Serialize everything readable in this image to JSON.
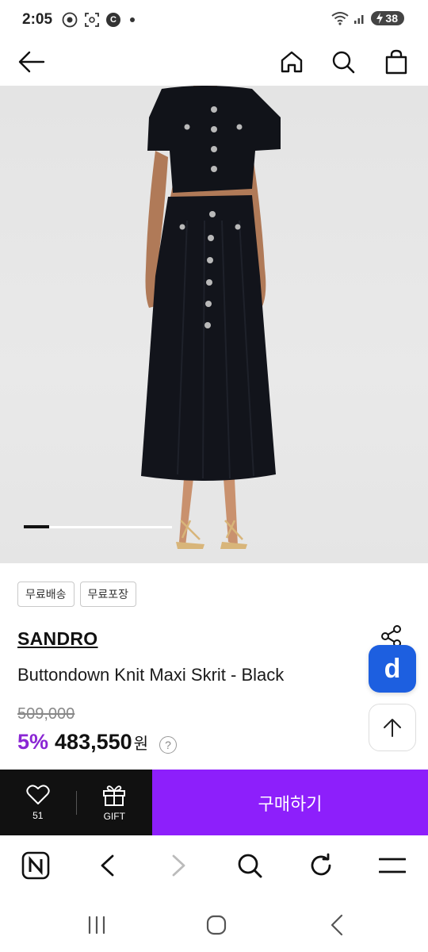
{
  "status_bar": {
    "time": "2:05",
    "notification_icon_label": "C",
    "battery": "38"
  },
  "top_nav": {
    "back_icon": "back-arrow-icon",
    "home_icon": "home-icon",
    "search_icon": "search-icon",
    "cart_icon": "shopping-bag-icon"
  },
  "product": {
    "tags": [
      "무료배송",
      "무료포장"
    ],
    "brand": "SANDRO",
    "name": "Buttondown Knit Maxi Skrit - Black",
    "original_price": "509,000",
    "discount": "5%",
    "sale_price": "483,550",
    "currency": "원",
    "info_symbol": "?",
    "image_carousel_progress": 0.17
  },
  "floating": {
    "badge_letter": "d"
  },
  "action_bar": {
    "like_count": "51",
    "gift_label": "GIFT",
    "buy_label": "구매하기"
  },
  "browser_bar": {
    "naver_label": "N"
  },
  "colors": {
    "accent_purple": "#8d1ffb",
    "discount_purple": "#8a26d4",
    "badge_blue": "#1d5fe0",
    "dark_bar": "#111111"
  }
}
